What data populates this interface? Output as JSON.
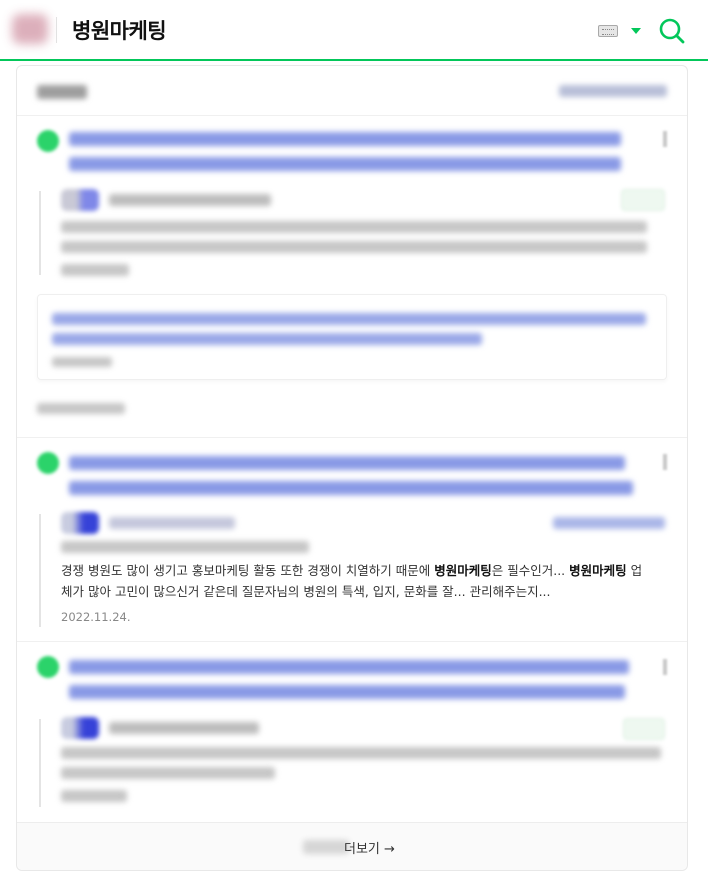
{
  "header": {
    "query": "병원마케팅",
    "icons": {
      "keyboard": "keyboard-icon",
      "dropdown": "caret-down-icon",
      "search": "search-icon"
    },
    "accent_color": "#03c75a"
  },
  "results": {
    "post2": {
      "snippet_parts": [
        {
          "text": "경쟁 병원도 많이 생기고 홍보마케팅 활동 또한 경쟁이 치열하기 때문에 ",
          "bold": false
        },
        {
          "text": "병원마케팅",
          "bold": true
        },
        {
          "text": "은 필수인거... ",
          "bold": false
        },
        {
          "text": "병원마케팅",
          "bold": true
        },
        {
          "text": " 업체가 많아 고민이 많으신거 같은데 질문자님의 병원의 특색, 입지, 문화를 잘... 관리해주는지...",
          "bold": false
        }
      ],
      "date": "2022.11.24."
    },
    "more_label": "더보기 →"
  }
}
